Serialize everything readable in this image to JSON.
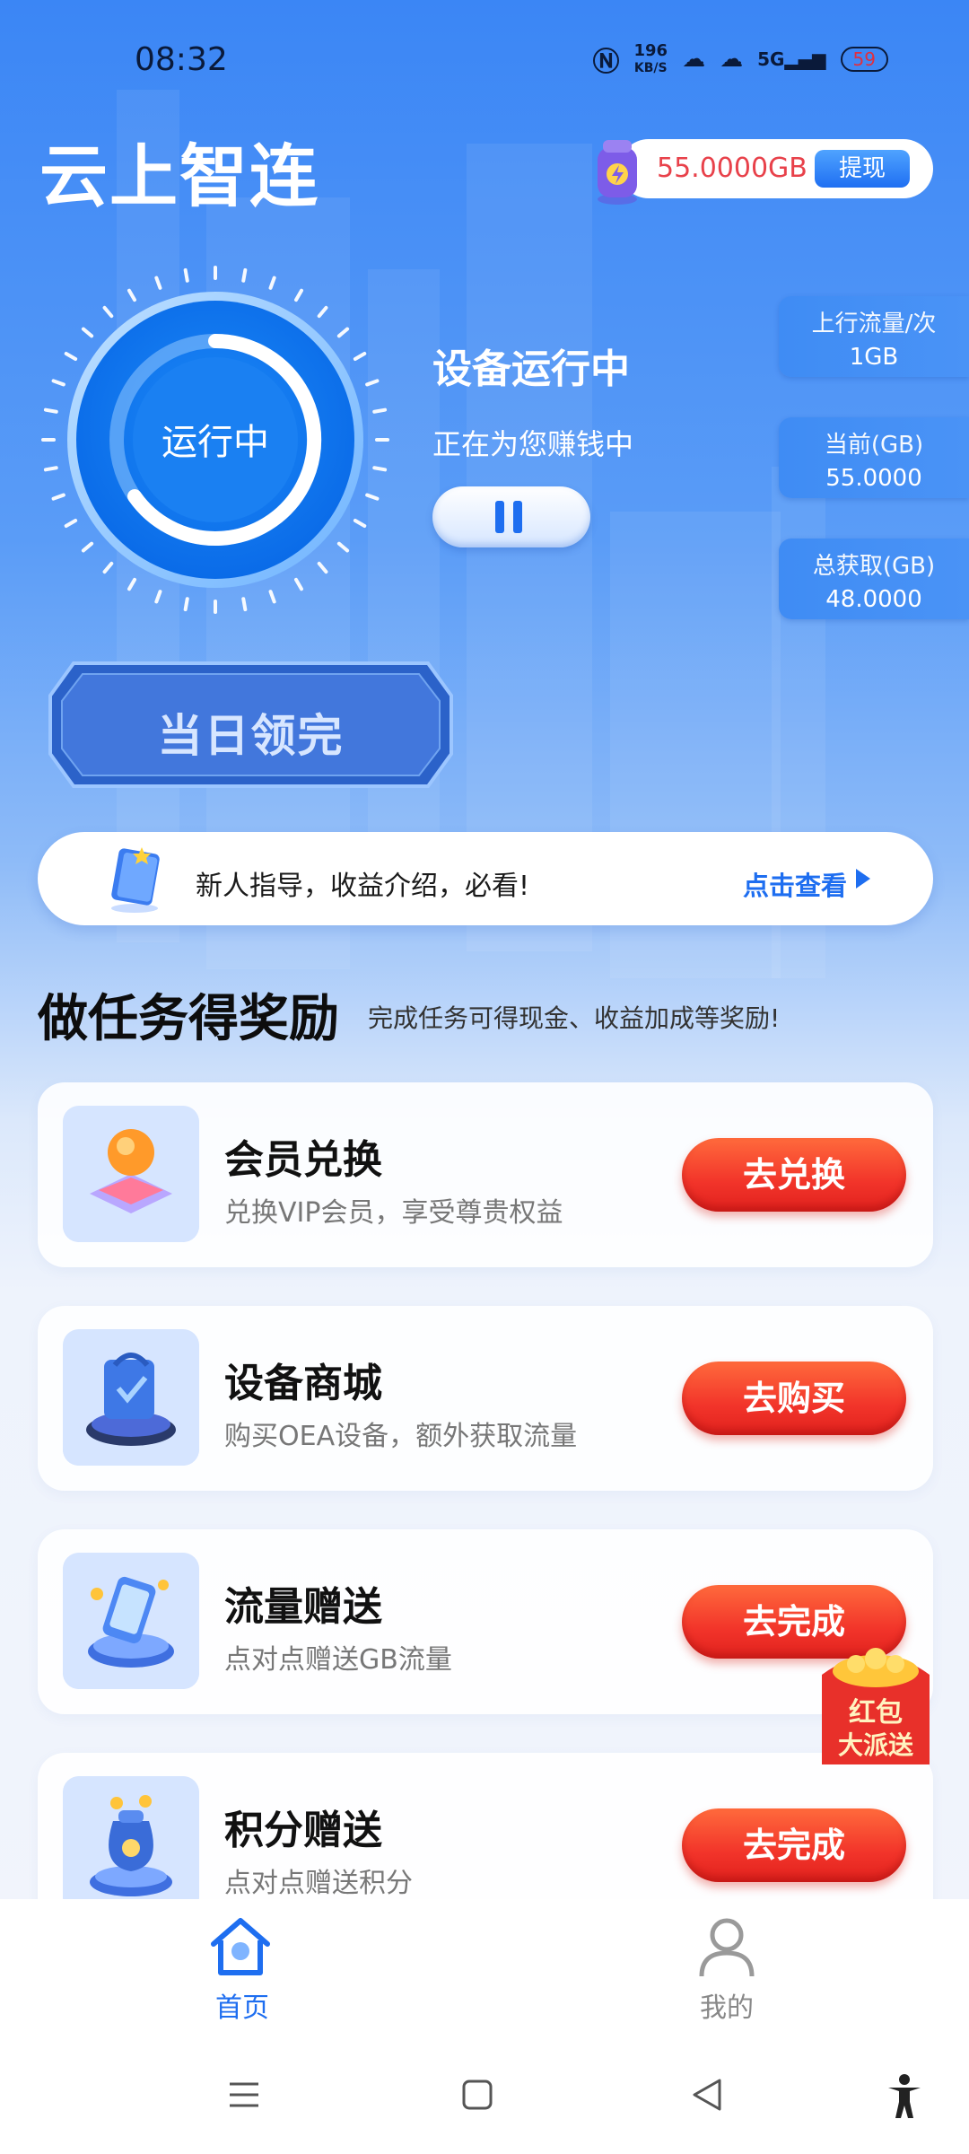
{
  "status_bar": {
    "time": "08:32",
    "net_speed": "196",
    "net_unit": "KB/S",
    "battery": "59",
    "icons": [
      "nfc-icon",
      "hd-icon",
      "wifi-icon",
      "5g-signal-icon",
      "battery-icon"
    ]
  },
  "header": {
    "title": "云上智连",
    "balance": "55.0000GB",
    "withdraw_label": "提现"
  },
  "device": {
    "dial_label": "运行中",
    "status_title": "设备运行中",
    "status_sub": "正在为您赚钱中"
  },
  "stats": [
    {
      "label": "上行流量/次",
      "value": "1GB"
    },
    {
      "label": "当前(GB)",
      "value": "55.0000"
    },
    {
      "label": "总获取(GB)",
      "value": "48.0000"
    }
  ],
  "claim": {
    "label": "当日领完"
  },
  "guide": {
    "text": "新人指导，收益介绍，必看!",
    "link": "点击查看"
  },
  "tasks_section": {
    "title": "做任务得奖励",
    "subtitle": "完成任务可得现金、收益加成等奖励!"
  },
  "tasks": [
    {
      "name": "会员兑换",
      "desc": "兑换VIP会员，享受尊贵权益",
      "button": "去兑换"
    },
    {
      "name": "设备商城",
      "desc": "购买OEA设备，额外获取流量",
      "button": "去购买"
    },
    {
      "name": "流量赠送",
      "desc": "点对点赠送GB流量",
      "button": "去完成"
    },
    {
      "name": "积分赠送",
      "desc": "点对点赠送积分",
      "button": "去完成"
    }
  ],
  "red_packet": {
    "line1": "红包",
    "line2": "大派送"
  },
  "bottom_nav": {
    "home": "首页",
    "me": "我的"
  },
  "colors": {
    "primary": "#1e6ef0",
    "accent_red": "#f2342a",
    "balance_red": "#e8414a"
  }
}
